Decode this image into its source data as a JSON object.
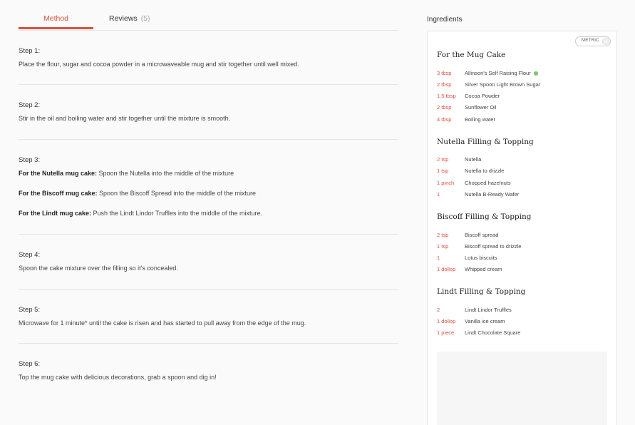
{
  "tabs": {
    "method": "Method",
    "reviews": "Reviews",
    "reviews_count": "(5)"
  },
  "steps": [
    {
      "title": "Step 1:",
      "lines": [
        {
          "bold": "",
          "text": "Place the flour, sugar and cocoa powder in a microwaveable mug and stir together until well mixed."
        }
      ]
    },
    {
      "title": "Step 2:",
      "lines": [
        {
          "bold": "",
          "text": "Stir in the oil and boiling water and stir together until the mixture is smooth."
        }
      ]
    },
    {
      "title": "Step 3:",
      "lines": [
        {
          "bold": "For the Nutella mug cake:",
          "text": " Spoon the Nutella into the middle of the mixture"
        },
        {
          "bold": "For the Biscoff mug cake:",
          "text": " Spoon the Biscoff Spread into the middle of the mixture"
        },
        {
          "bold": "For the Lindt mug cake:",
          "text": " Push the Lindt Lindor Truffles into the middle of the mixture."
        }
      ]
    },
    {
      "title": "Step 4:",
      "lines": [
        {
          "bold": "",
          "text": "Spoon the cake mixture over the filling so it's concealed."
        }
      ]
    },
    {
      "title": "Step 5:",
      "lines": [
        {
          "bold": "",
          "text": "Microwave for 1 minute* until the cake is risen and has started to pull away from the edge of the mug."
        }
      ]
    },
    {
      "title": "Step 6:",
      "lines": [
        {
          "bold": "",
          "text": "Top the mug cake with delicious decorations, grab a spoon and dig in!"
        }
      ]
    }
  ],
  "ingredients": {
    "heading": "Ingredients",
    "unit_toggle": "METRIC",
    "groups": [
      {
        "title": "For the Mug Cake",
        "items": [
          {
            "qty": "3 tbsp",
            "name": "Allinson's Self Raising Flour",
            "info_icon": "info-dot-icon"
          },
          {
            "qty": "2 tbsp",
            "name": "Silver Spoon Light Brown Sugar"
          },
          {
            "qty": "1.5 tbsp",
            "name": "Cocoa Powder"
          },
          {
            "qty": "2 tbsp",
            "name": "Sunflower Oil"
          },
          {
            "qty": "4 tbsp",
            "name": "Boiling water"
          }
        ]
      },
      {
        "title": "Nutella Filling & Topping",
        "items": [
          {
            "qty": "2 tsp",
            "name": "Nutella"
          },
          {
            "qty": "1 tsp",
            "name": "Nutella to drizzle"
          },
          {
            "qty": "1 pinch",
            "name": "Chopped hazelnuts"
          },
          {
            "qty": "1",
            "name": "Nutella B-Ready Wafer"
          }
        ]
      },
      {
        "title": "Biscoff Filling & Topping",
        "items": [
          {
            "qty": "2 tsp",
            "name": "Biscoff spread"
          },
          {
            "qty": "1 tsp",
            "name": "Biscoff spread to drizzle"
          },
          {
            "qty": "1",
            "name": "Lotus biscuits"
          },
          {
            "qty": "1 dollop",
            "name": "Whipped cream"
          }
        ]
      },
      {
        "title": "Lindt Filling & Topping",
        "items": [
          {
            "qty": "2",
            "name": "Lindt Lindor Truffles"
          },
          {
            "qty": "1 dollop",
            "name": "Vanilla ice cream"
          },
          {
            "qty": "1 piece",
            "name": "Lindt Chocolate Square"
          }
        ]
      }
    ]
  },
  "colors": {
    "accent": "#d9523f",
    "info_green": "#7cc26b"
  }
}
